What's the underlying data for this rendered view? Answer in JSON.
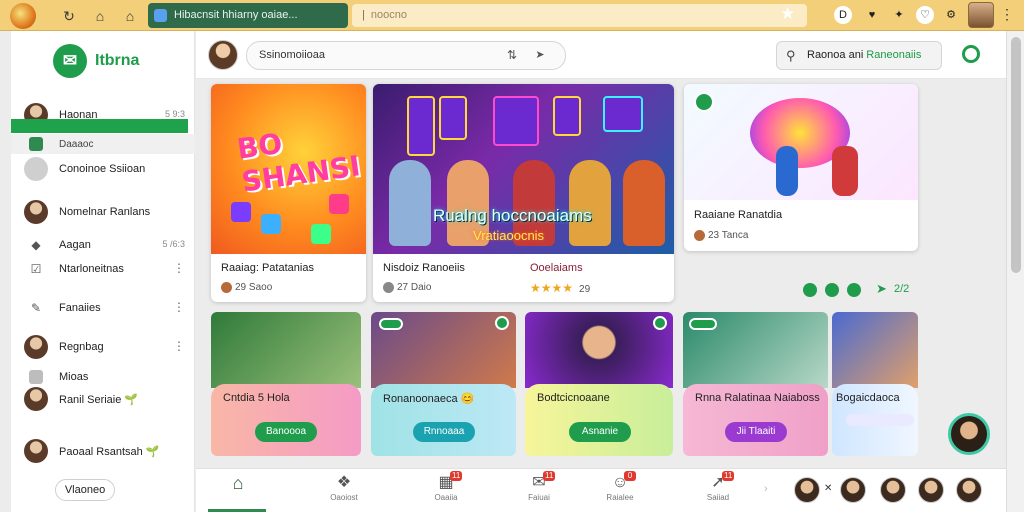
{
  "browser": {
    "tab_title": "Hibacnsit hhiarny oaiae...",
    "address": "noocno",
    "extension_labels": [
      "D",
      "♥",
      "✦",
      "♡",
      "⚙"
    ]
  },
  "sidebar": {
    "brand": "Itbrna",
    "items": [
      {
        "label": "Haonan",
        "meta": "5 9:3"
      },
      {
        "label": "Daaaoc"
      },
      {
        "label": "Conoinoe Ssiioan"
      },
      {
        "label": "Nomelnar Ranlans"
      },
      {
        "label": "Aagan",
        "meta": "5 /6:3"
      },
      {
        "label": "Ntarloneitnas"
      },
      {
        "label": "Fanaiies"
      },
      {
        "label": "Regnbag"
      },
      {
        "label": "Mioas"
      },
      {
        "label": "Ranil Seriaie 🌱"
      },
      {
        "label": "Paoaal Rsantsah 🌱"
      }
    ],
    "view_button": "Vlaoneo"
  },
  "topbar": {
    "search_value": "Ssinomoiioaa",
    "search_secondary_prefix": "Raonoa ani",
    "search_secondary_highlight": "Raneonaiis"
  },
  "cards": {
    "bingo": {
      "image_text": "BO SHANSI",
      "title": "Raaiag: Patatanias",
      "meta": "29 Saoo"
    },
    "game": {
      "image_text": "Rualng hoccnoaiams",
      "image_text_2": "Vratiaoocnis",
      "title": "Nisdoiz Ranoeiis",
      "title_right": "Ooelaiams",
      "meta": "27 Daio",
      "rating": "29"
    },
    "kids": {
      "title": "Raaiane Ranatdia",
      "meta": "23 Tanca"
    }
  },
  "pagination": {
    "label": "2/2"
  },
  "small_cards": [
    {
      "title": "Cntdia 5 Hola",
      "button": "Banoooa"
    },
    {
      "title": "Ronanoonaeca 😊",
      "button": "Rnnoaaa"
    },
    {
      "title": "Bodtcicnoaane",
      "button": "Asnanie"
    },
    {
      "title": "Rnna Ralatinaa Naiaboss",
      "button": "Jii Tlaaiti"
    },
    {
      "title": "Bogaicdaoca"
    }
  ],
  "bottom_nav": [
    {
      "label": "Home",
      "icon": "home-icon"
    },
    {
      "label": "Oaoiost",
      "icon": "chat-icon"
    },
    {
      "label": "Oaaiia",
      "icon": "calendar-icon",
      "count": "11"
    },
    {
      "label": "Faiuai",
      "icon": "mail-icon",
      "count": "11"
    },
    {
      "label": "Raialee",
      "icon": "people-icon",
      "count": "0"
    },
    {
      "label": "Saiiad",
      "icon": "share-icon",
      "count": "11"
    }
  ],
  "colors": {
    "accent": "#1f9d4c",
    "chrome": "#f3cf7a"
  }
}
